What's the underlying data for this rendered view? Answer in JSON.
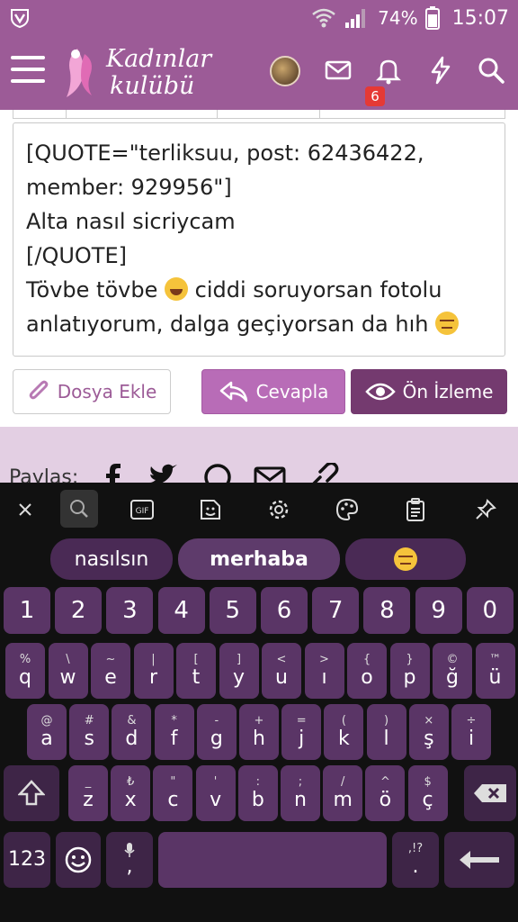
{
  "status_bar": {
    "battery_pct": "74%",
    "time": "15:07"
  },
  "header": {
    "logo_line1": "Kadınlar",
    "logo_line2": "kulübü",
    "notification_count": "6"
  },
  "editor": {
    "lines": [
      "[QUOTE=\"terliksuu, post: 62436422,",
      "member: 929956\"]",
      "Alta nasıl sicriycam",
      "[/QUOTE]",
      "Tövbe tövbe",
      "ciddi soruyorsan fotolu",
      "anlatıyorum, dalga geçiyorsan da hıh"
    ]
  },
  "actions": {
    "attach": "Dosya Ekle",
    "reply": "Cevapla",
    "preview": "Ön İzleme"
  },
  "share": {
    "label": "Paylaş:"
  },
  "keyboard": {
    "suggestions": [
      "nasılsın",
      "merhaba"
    ],
    "numbers": [
      "1",
      "2",
      "3",
      "4",
      "5",
      "6",
      "7",
      "8",
      "9",
      "0"
    ],
    "row1": [
      {
        "main": "q",
        "sub": "%"
      },
      {
        "main": "w",
        "sub": "\\"
      },
      {
        "main": "e",
        "sub": "~"
      },
      {
        "main": "r",
        "sub": "|"
      },
      {
        "main": "t",
        "sub": "["
      },
      {
        "main": "y",
        "sub": "]"
      },
      {
        "main": "u",
        "sub": "<"
      },
      {
        "main": "ı",
        "sub": ">"
      },
      {
        "main": "o",
        "sub": "{"
      },
      {
        "main": "p",
        "sub": "}"
      },
      {
        "main": "ğ",
        "sub": "©"
      },
      {
        "main": "ü",
        "sub": "™"
      }
    ],
    "row2": [
      {
        "main": "a",
        "sub": "@"
      },
      {
        "main": "s",
        "sub": "#"
      },
      {
        "main": "d",
        "sub": "&"
      },
      {
        "main": "f",
        "sub": "*"
      },
      {
        "main": "g",
        "sub": "-"
      },
      {
        "main": "h",
        "sub": "+"
      },
      {
        "main": "j",
        "sub": "="
      },
      {
        "main": "k",
        "sub": "("
      },
      {
        "main": "l",
        "sub": ")"
      },
      {
        "main": "ş",
        "sub": "×"
      },
      {
        "main": "i",
        "sub": "÷"
      }
    ],
    "row3": [
      {
        "main": "z",
        "sub": "_"
      },
      {
        "main": "x",
        "sub": "₺"
      },
      {
        "main": "c",
        "sub": "\""
      },
      {
        "main": "v",
        "sub": "'"
      },
      {
        "main": "b",
        "sub": ":"
      },
      {
        "main": "n",
        "sub": ";"
      },
      {
        "main": "m",
        "sub": "/"
      },
      {
        "main": "ö",
        "sub": "^"
      },
      {
        "main": "ç",
        "sub": "$"
      }
    ],
    "symbols_key": "123",
    "comma": ",",
    "comma_sub": "🎤",
    "period": ".",
    "period_sub": ",!?"
  }
}
